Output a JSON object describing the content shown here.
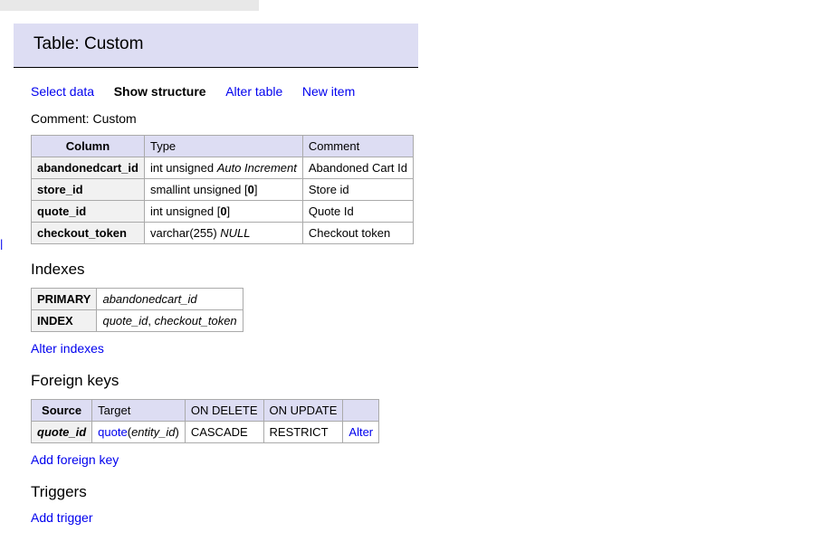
{
  "title_prefix": "Table: ",
  "title_name": "Custom",
  "tabs": {
    "select_data": "Select data",
    "show_structure": "Show structure",
    "alter_table": "Alter table",
    "new_item": "New item"
  },
  "comment_label": "Comment: ",
  "comment_value": "Custom",
  "columns_header": {
    "column": "Column",
    "type": "Type",
    "comment": "Comment"
  },
  "columns": [
    {
      "name": "abandonedcart_id",
      "type_base": "int unsigned ",
      "type_extra_italic": "Auto Increment",
      "type_bracket_bold": "",
      "type_trail_italic": "",
      "comment": "Abandoned Cart Id"
    },
    {
      "name": "store_id",
      "type_base": "smallint unsigned [",
      "type_extra_italic": "",
      "type_bracket_bold": "0",
      "type_trail_plain": "]",
      "type_trail_italic": "",
      "comment": "Store id"
    },
    {
      "name": "quote_id",
      "type_base": "int unsigned [",
      "type_extra_italic": "",
      "type_bracket_bold": "0",
      "type_trail_plain": "]",
      "type_trail_italic": "",
      "comment": "Quote Id"
    },
    {
      "name": "checkout_token",
      "type_base": "varchar(255) ",
      "type_extra_italic": "",
      "type_bracket_bold": "",
      "type_trail_plain": "",
      "type_trail_italic": "NULL",
      "comment": "Checkout token"
    }
  ],
  "indexes_heading": "Indexes",
  "indexes": [
    {
      "kind": "PRIMARY",
      "cols_italic": "abandonedcart_id"
    },
    {
      "kind": "INDEX",
      "cols_italic_a": "quote_id",
      "sep": ", ",
      "cols_italic_b": "checkout_token"
    }
  ],
  "alter_indexes": "Alter indexes",
  "fk_heading": "Foreign keys",
  "fk_header": {
    "source": "Source",
    "target": "Target",
    "on_delete": "ON DELETE",
    "on_update": "ON UPDATE"
  },
  "fk_rows": [
    {
      "source": "quote_id",
      "target_link": "quote",
      "target_suffix_italic": "entity_id",
      "on_delete": "CASCADE",
      "on_update": "RESTRICT",
      "alter": "Alter"
    }
  ],
  "add_fk": "Add foreign key",
  "triggers_heading": "Triggers",
  "add_trigger": "Add trigger"
}
